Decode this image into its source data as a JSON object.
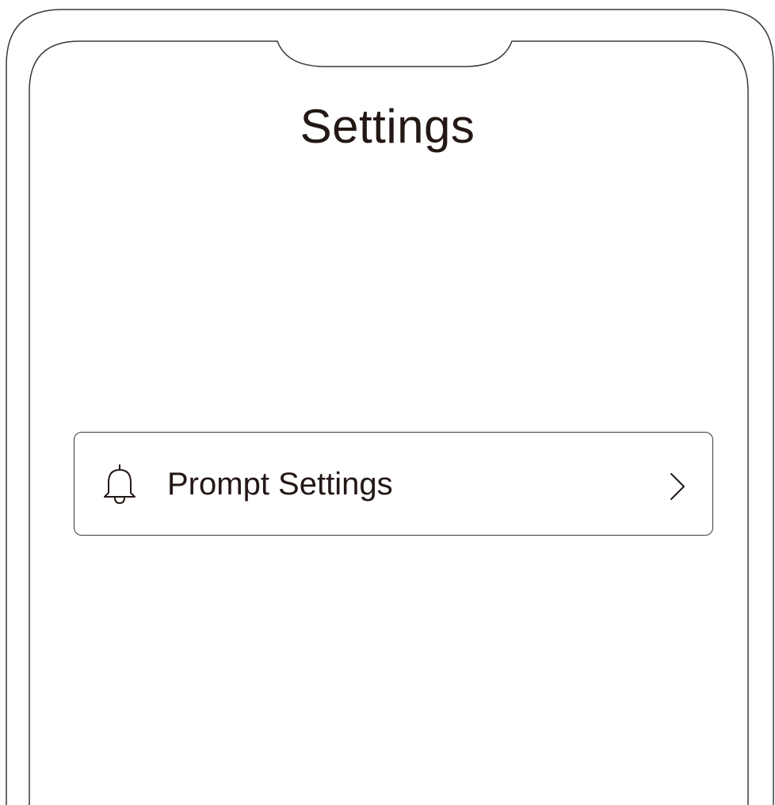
{
  "screen": {
    "title": "Settings"
  },
  "settings": {
    "items": [
      {
        "label": "Prompt Settings",
        "icon": "bell-icon",
        "trailing_icon": "chevron-right-icon"
      }
    ]
  },
  "colors": {
    "text": "#231815",
    "frame_stroke": "#3a3a3a",
    "background": "#ffffff"
  }
}
